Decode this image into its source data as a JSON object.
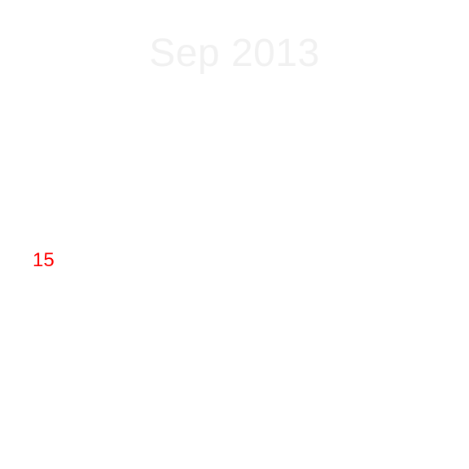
{
  "calendar": {
    "month_label": "Sep 2013",
    "days": [
      {
        "label": "15",
        "color": "#ff0000"
      }
    ]
  },
  "colors": {
    "background": "#ffffff",
    "header_text": "#f1f1f1",
    "highlight_day": "#ff0000"
  }
}
